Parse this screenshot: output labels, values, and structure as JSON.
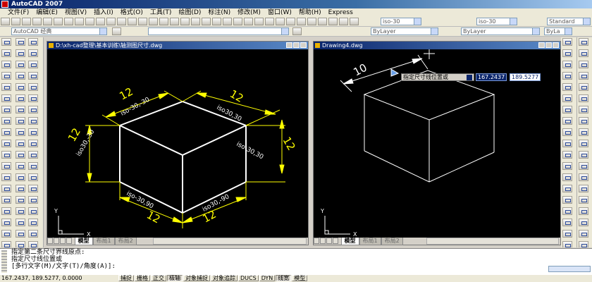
{
  "app": {
    "title": "AutoCAD 2007"
  },
  "menu": [
    "文件(F)",
    "编辑(E)",
    "视图(V)",
    "插入(I)",
    "格式(O)",
    "工具(T)",
    "绘图(D)",
    "标注(N)",
    "修改(M)",
    "窗口(W)",
    "帮助(H)",
    "Express"
  ],
  "toolbar": {
    "workspace": "AutoCAD 经典",
    "dim_style_1": "iso-30",
    "dim_style_2": "iso-30",
    "text_style": "Standard",
    "layer_combo": "ByLayer",
    "linetype_combo": "ByLayer",
    "lineweight_combo": "ByLayer",
    "plot_combo": "ByLa"
  },
  "window1": {
    "title": "D:\\xh-cad整理\\基本训练\\轴测图尺寸.dwg",
    "tabs": [
      "模型",
      "布局1",
      "布局2"
    ],
    "labels": {
      "dim_top_left": "12",
      "dim_top_right": "12",
      "dim_left": "12",
      "dim_right": "12",
      "dim_bottom_left": "12",
      "dim_bottom_right": "12",
      "style_top_left": "iso-30,-30",
      "style_top_right": "iso30,30",
      "style_left": "iso30,-30",
      "style_right": "iso-30,30",
      "style_bottom_left": "iso-30,90",
      "style_bottom_right": "iso30,-90"
    },
    "ucs": {
      "x": "X",
      "y": "Y"
    }
  },
  "window2": {
    "title": "Drawing4.dwg",
    "tabs": [
      "模型",
      "布局1",
      "布局2"
    ],
    "dim_value": "10",
    "prompt": "指定尺寸线位置或",
    "input_x": "167.2437",
    "input_y": "189.5277",
    "ucs": {
      "x": "X",
      "y": "Y"
    }
  },
  "command": {
    "lines": [
      "指定第二条尺寸界线原点:",
      "指定尺寸线位置或",
      "[多行文字(M)/文字(T)/角度(A)]:"
    ]
  },
  "status": {
    "coords": "167.2437, 189.5277, 0.0000",
    "modes": [
      {
        "label": "捕捉",
        "on": false
      },
      {
        "label": "栅格",
        "on": false
      },
      {
        "label": "正交",
        "on": false
      },
      {
        "label": "极轴",
        "on": true
      },
      {
        "label": "对象捕捉",
        "on": false
      },
      {
        "label": "对象追踪",
        "on": false
      },
      {
        "label": "DUCS",
        "on": false
      },
      {
        "label": "DYN",
        "on": false
      },
      {
        "label": "线宽",
        "on": true
      },
      {
        "label": "模型",
        "on": false
      }
    ]
  },
  "colors": {
    "dim": "#ffff00",
    "geometry": "#ffffff",
    "canvas": "#000000",
    "dyn_input": "#0a246a"
  }
}
